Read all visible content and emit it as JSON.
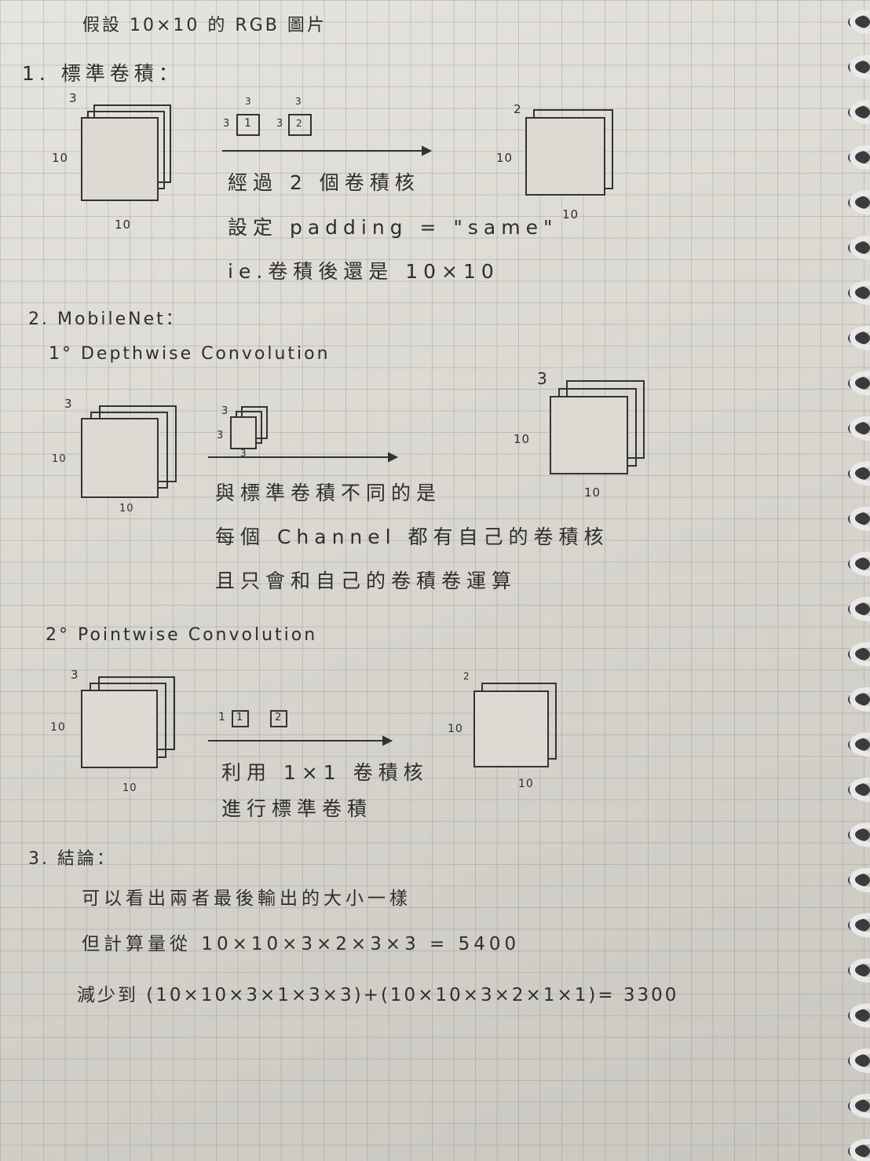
{
  "title": "假設 10×10 的 RGB 圖片",
  "section1": {
    "heading": "1. 標準卷積：",
    "input_depth": "3",
    "input_height": "10",
    "input_width": "10",
    "kernel1_h": "3",
    "kernel1_w": "3",
    "kernel1_label": "1",
    "kernel2_h": "3",
    "kernel2_w": "3",
    "kernel2_label": "2",
    "line1": "經過 2 個卷積核",
    "line2": "設定 padding = \"same\"",
    "line3": "ie.卷積後還是 10×10",
    "output_depth": "2",
    "output_height": "10",
    "output_width": "10"
  },
  "section2": {
    "heading": "2. MobileNet：",
    "sub1": {
      "heading": "1° Depthwise Convolution",
      "input_depth": "3",
      "input_height": "10",
      "input_width": "10",
      "kernel_depth": "3",
      "kernel_h": "3",
      "kernel_w": "3",
      "line1": "與標準卷積不同的是",
      "line2": "每個 Channel 都有自己的卷積核",
      "line3": "且只會和自己的卷積卷運算",
      "output_depth": "3",
      "output_height": "10",
      "output_width": "10"
    },
    "sub2": {
      "heading": "2° Pointwise Convolution",
      "input_depth": "3",
      "input_height": "10",
      "input_width": "10",
      "kernel1_size": "1",
      "kernel1_label": "1",
      "kernel2_label": "2",
      "line1": "利用 1×1 卷積核",
      "line2": "進行標準卷積",
      "output_depth": "2",
      "output_height": "10",
      "output_width": "10"
    }
  },
  "section3": {
    "heading": "3. 結論：",
    "line1": "可以看出兩者最後輸出的大小一樣",
    "line2": "但計算量從 10×10×3×2×3×3 = 5400",
    "line3": "減少到 (10×10×3×1×3×3)+(10×10×3×2×1×1)= 3300"
  }
}
